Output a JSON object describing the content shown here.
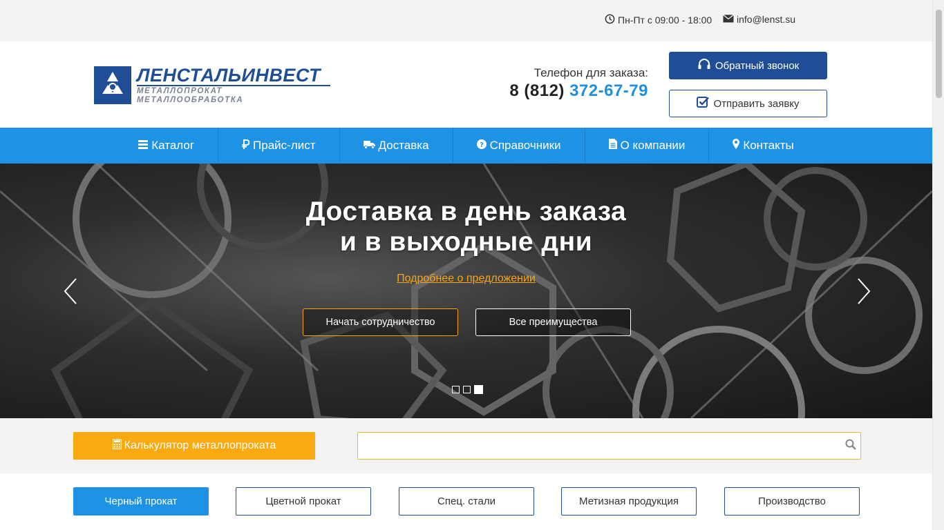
{
  "topbar": {
    "hours": "Пн-Пт с 09:00 - 18:00",
    "email": "info@lenst.su"
  },
  "header": {
    "logo_brand": "ЛЕНСТАЛЬИНВЕСТ",
    "logo_sub": "МЕТАЛЛОПРОКАТ МЕТАЛЛООБРАБОТКА",
    "phone_label": "Телефон для заказа:",
    "phone_prefix": "8 (812)",
    "phone_number": "372-67-79",
    "callback_label": "Обратный звонок",
    "request_label": "Отправить заявку"
  },
  "nav": {
    "items": [
      {
        "label": "Каталог",
        "icon": "bars-icon"
      },
      {
        "label": "Прайс-лист",
        "icon": "ruble-icon"
      },
      {
        "label": "Доставка",
        "icon": "truck-icon"
      },
      {
        "label": "Справочники",
        "icon": "question-circle-icon"
      },
      {
        "label": "О компании",
        "icon": "document-icon"
      },
      {
        "label": "Контакты",
        "icon": "map-marker-icon"
      }
    ]
  },
  "hero": {
    "title_line1": "Доставка в день заказа",
    "title_line2": "и в выходные дни",
    "more_link": "Подробнее о предложении",
    "btn_start": "Начать сотрудничество",
    "btn_all": "Все преимущества",
    "slides_count": 3,
    "active_slide": 3
  },
  "tools": {
    "calc_label": "Калькулятор металлопроката",
    "search_value": "",
    "search_placeholder": ""
  },
  "categories": [
    {
      "label": "Черный прокат",
      "active": true
    },
    {
      "label": "Цветной прокат",
      "active": false
    },
    {
      "label": "Спец. стали",
      "active": false
    },
    {
      "label": "Метизная продукция",
      "active": false
    },
    {
      "label": "Производство",
      "active": false
    }
  ],
  "colors": {
    "brand_dark_blue": "#1f4e96",
    "nav_blue": "#1e93e6",
    "accent_orange": "#f9aa12",
    "phone_highlight": "#1e8fe1"
  }
}
